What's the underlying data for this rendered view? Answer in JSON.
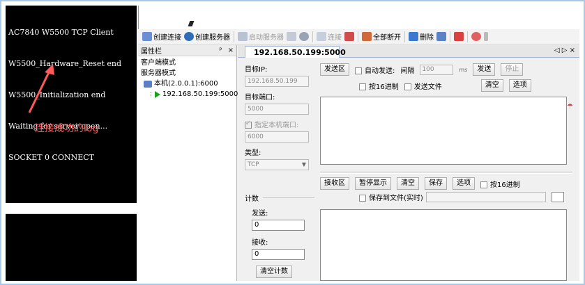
{
  "terminal": {
    "lines": [
      "AC7840 W5500 TCP Client",
      "W5500_Hardware_Reset end",
      "W5500_Initialization end",
      "Waiting for server open...",
      "SOCKET 0 CONNECT"
    ],
    "annotation": "连接成功的log",
    "annotation_color": "#ff5a5a"
  },
  "toolbar": {
    "items": [
      {
        "label": "创建连接",
        "icon": "create-connection-icon",
        "enabled": true
      },
      {
        "label": "创建服务器",
        "icon": "create-server-icon",
        "enabled": true
      },
      {
        "label": "启动服务器",
        "icon": "start-server-icon",
        "enabled": false
      },
      {
        "label": "连接",
        "icon": "connect-icon",
        "enabled": false
      },
      {
        "label": "全部断开",
        "icon": "disconnect-all-icon",
        "enabled": true
      },
      {
        "label": "删除",
        "icon": "delete-icon",
        "enabled": true
      }
    ]
  },
  "property_panel": {
    "title": "属性栏",
    "pin": "ᵖ",
    "close": "×",
    "tree": {
      "client_mode": "客户端模式",
      "server_mode": "服务器模式",
      "local": "本机(2.0.0.1):6000",
      "connection": "192.168.50.199:5000"
    }
  },
  "doc": {
    "tab_title": "192.168.50.199:5000",
    "tab_controls": "◁ ▷ ×",
    "target_ip_label": "目标IP:",
    "target_ip": "192.168.50.199",
    "target_port_label": "目标端口:",
    "target_port": "5000",
    "local_port_label": "指定本机端口:",
    "local_port": "6000",
    "type_label": "类型:",
    "type_value": "TCP",
    "count_label": "计数",
    "sent_label": "发送:",
    "sent_value": "0",
    "recv_label": "接收:",
    "recv_value": "0",
    "clear_count": "清空计数"
  },
  "send": {
    "area_label": "发送区",
    "auto_send": "自动发送:",
    "interval_label": "间隔",
    "interval_value": "100",
    "ms": "ms",
    "send_btn": "发送",
    "stop_btn": "停止",
    "hex": "按16进制",
    "send_file": "发送文件",
    "clear_btn": "清空",
    "options_btn": "选项"
  },
  "recv": {
    "area_label": "接收区",
    "pause": "暂停显示",
    "clear": "清空",
    "save": "保存",
    "options": "选项",
    "hex": "按16进制",
    "save_to_file": "保存到文件(实时)"
  }
}
